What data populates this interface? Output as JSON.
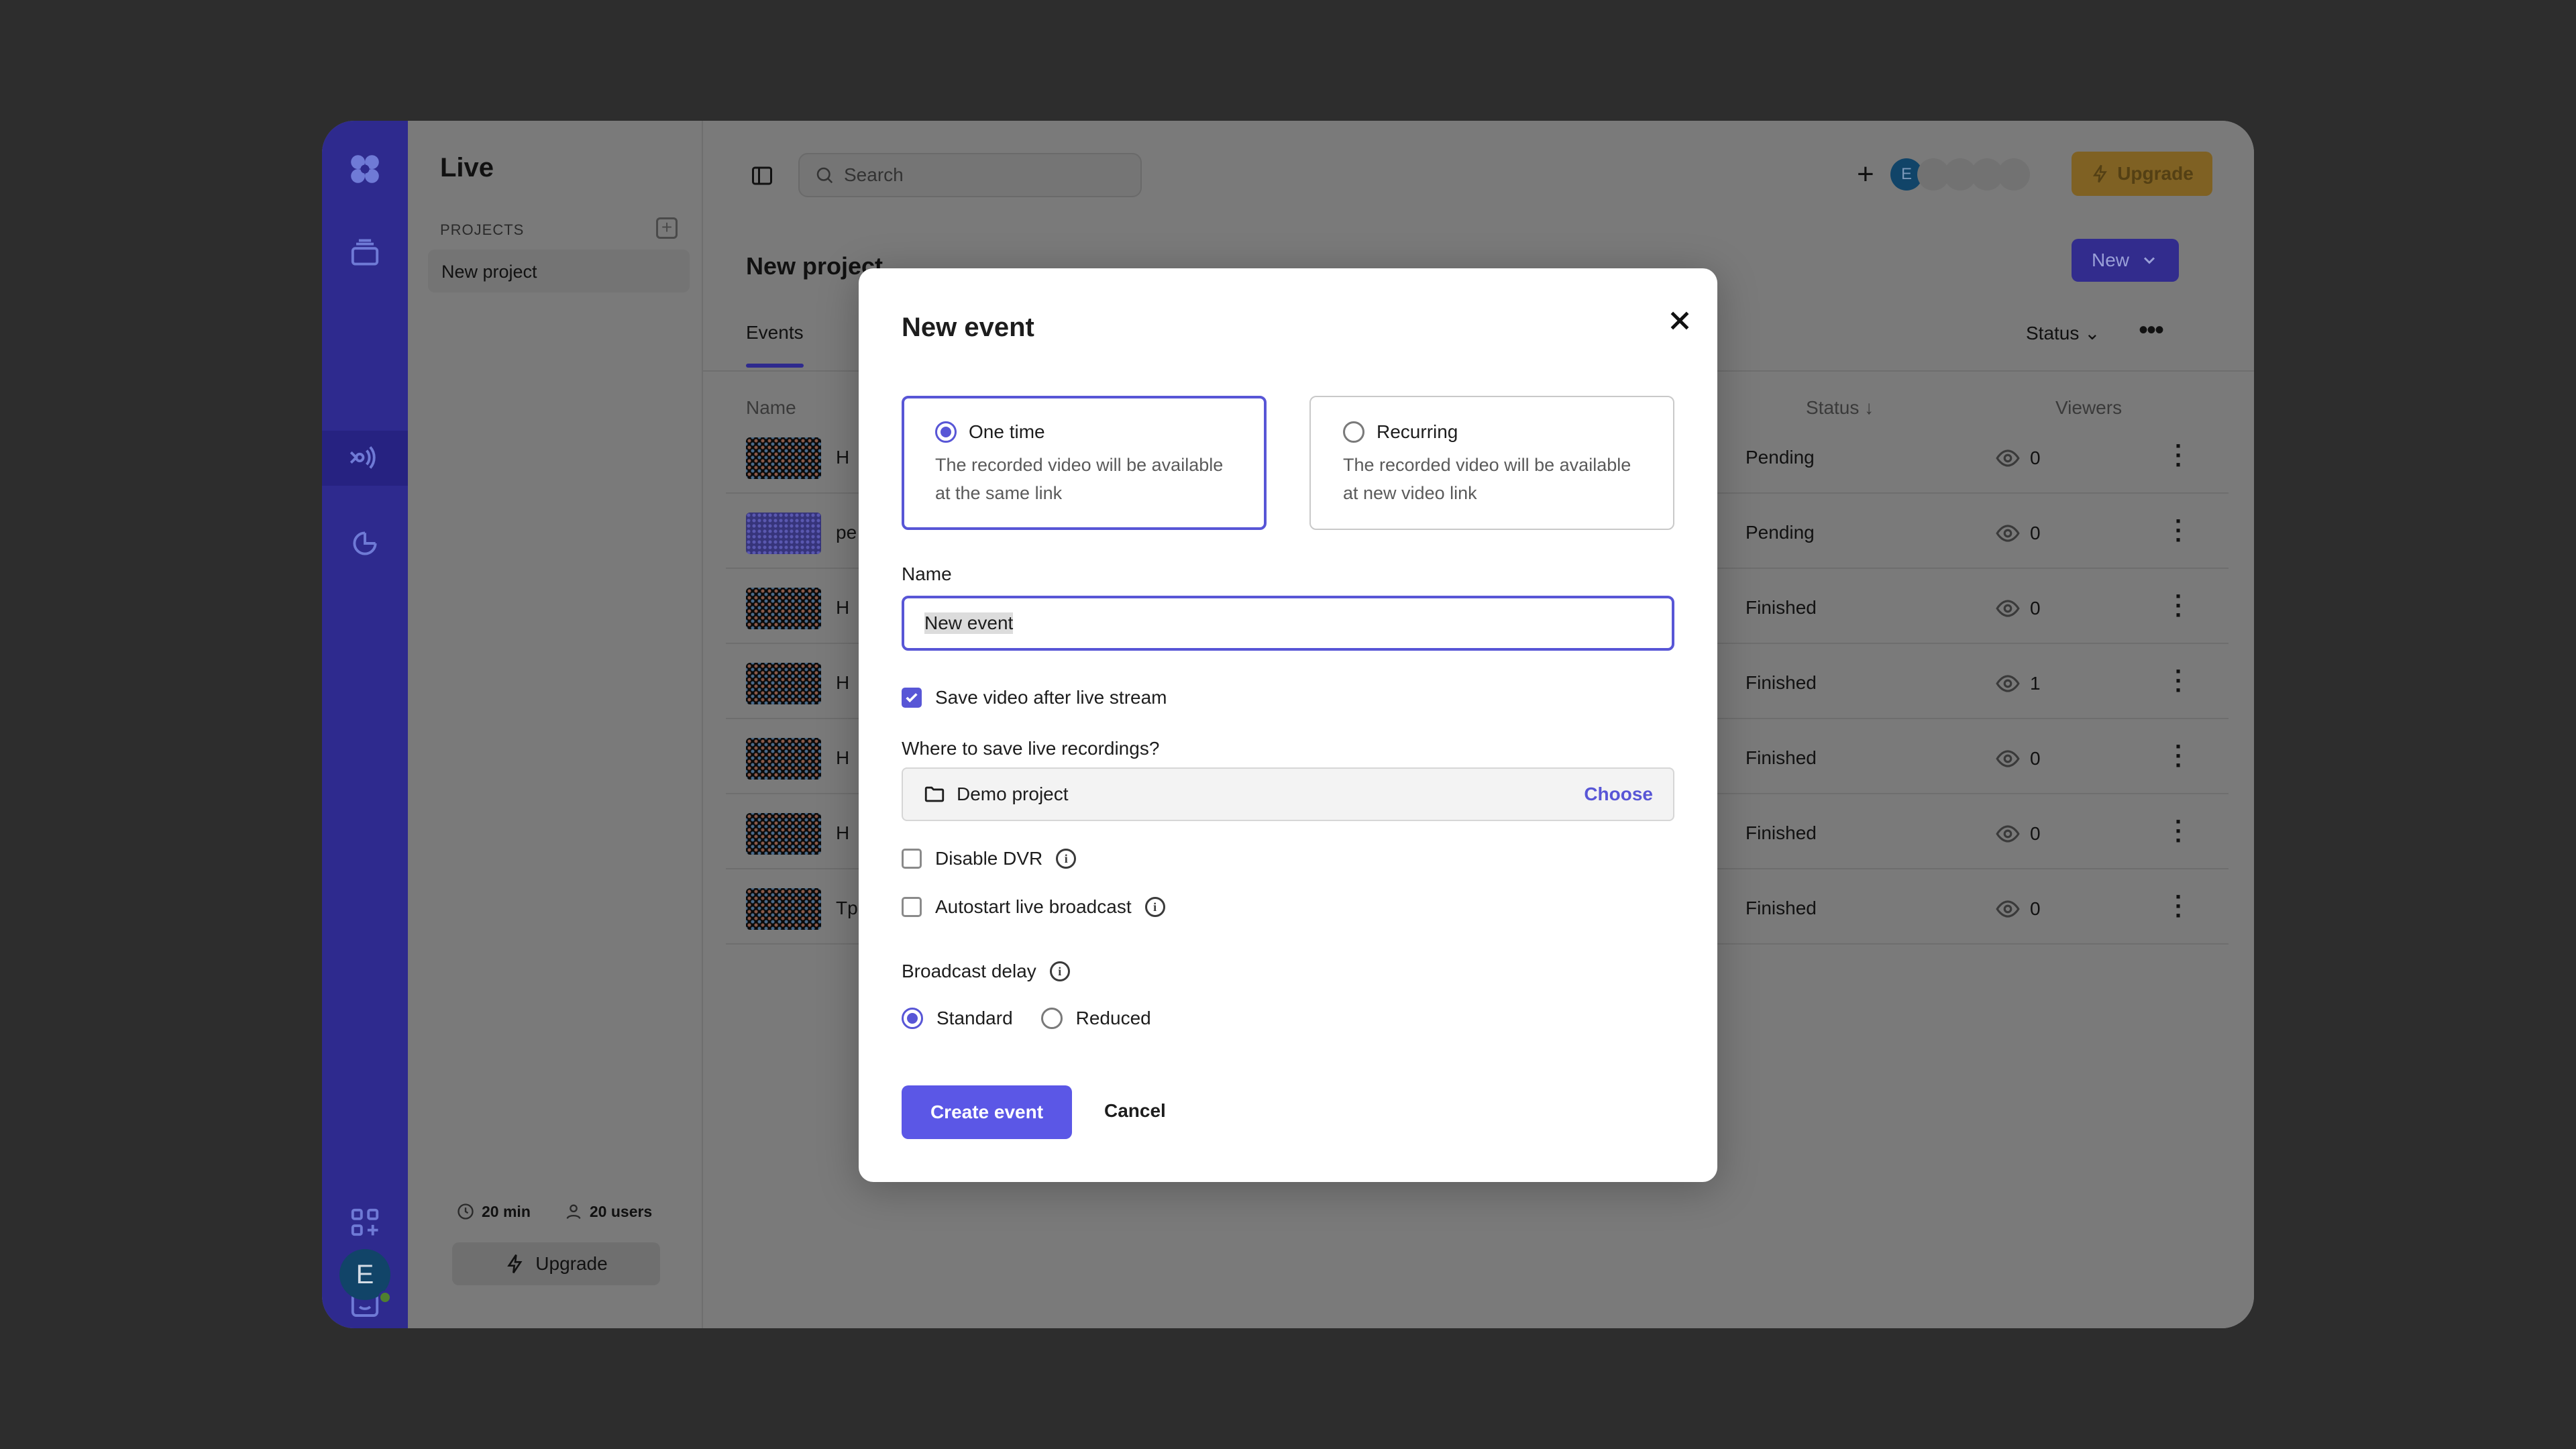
{
  "sidebar": {
    "title": "Live",
    "section_label": "PROJECTS",
    "project": "New project",
    "usage_minutes": "20 min",
    "usage_users": "20 users",
    "upgrade_label": "Upgrade"
  },
  "rail": {
    "avatar_initial": "E"
  },
  "topbar": {
    "search_placeholder": "Search",
    "avatar_initial": "E",
    "upgrade_label": "Upgrade"
  },
  "main": {
    "page_title": "New project",
    "new_button": "New",
    "tab_events": "Events",
    "status_filter": "Status",
    "columns": {
      "name": "Name",
      "status": "Status",
      "viewers": "Viewers"
    },
    "rows": [
      {
        "name": "H",
        "status": "Pending",
        "viewers": "0"
      },
      {
        "name": "pe",
        "status": "Pending",
        "viewers": "0"
      },
      {
        "name": "H",
        "status": "Finished",
        "viewers": "0"
      },
      {
        "name": "H",
        "status": "Finished",
        "viewers": "1"
      },
      {
        "name": "H",
        "status": "Finished",
        "viewers": "0"
      },
      {
        "name": "H",
        "status": "Finished",
        "viewers": "0"
      },
      {
        "name": "Tp",
        "status": "Finished",
        "viewers": "0"
      }
    ]
  },
  "modal": {
    "title": "New event",
    "one_time": {
      "label": "One time",
      "description": "The recorded video will be available at the same link",
      "selected": true
    },
    "recurring": {
      "label": "Recurring",
      "description": "The recorded video will be available at new video link",
      "selected": false
    },
    "name_label": "Name",
    "name_value": "New event",
    "save_video_label": "Save video after live stream",
    "save_video_checked": true,
    "where_label": "Where to save live recordings?",
    "folder_name": "Demo project",
    "choose_label": "Choose",
    "disable_dvr_label": "Disable DVR",
    "autostart_label": "Autostart live broadcast",
    "delay_label": "Broadcast delay",
    "delay_standard": "Standard",
    "delay_reduced": "Reduced",
    "create_label": "Create event",
    "cancel_label": "Cancel"
  },
  "colors": {
    "accent": "#5856d6",
    "rail": "#2e2a8e",
    "overlay_bg": "#2d2d2d"
  }
}
